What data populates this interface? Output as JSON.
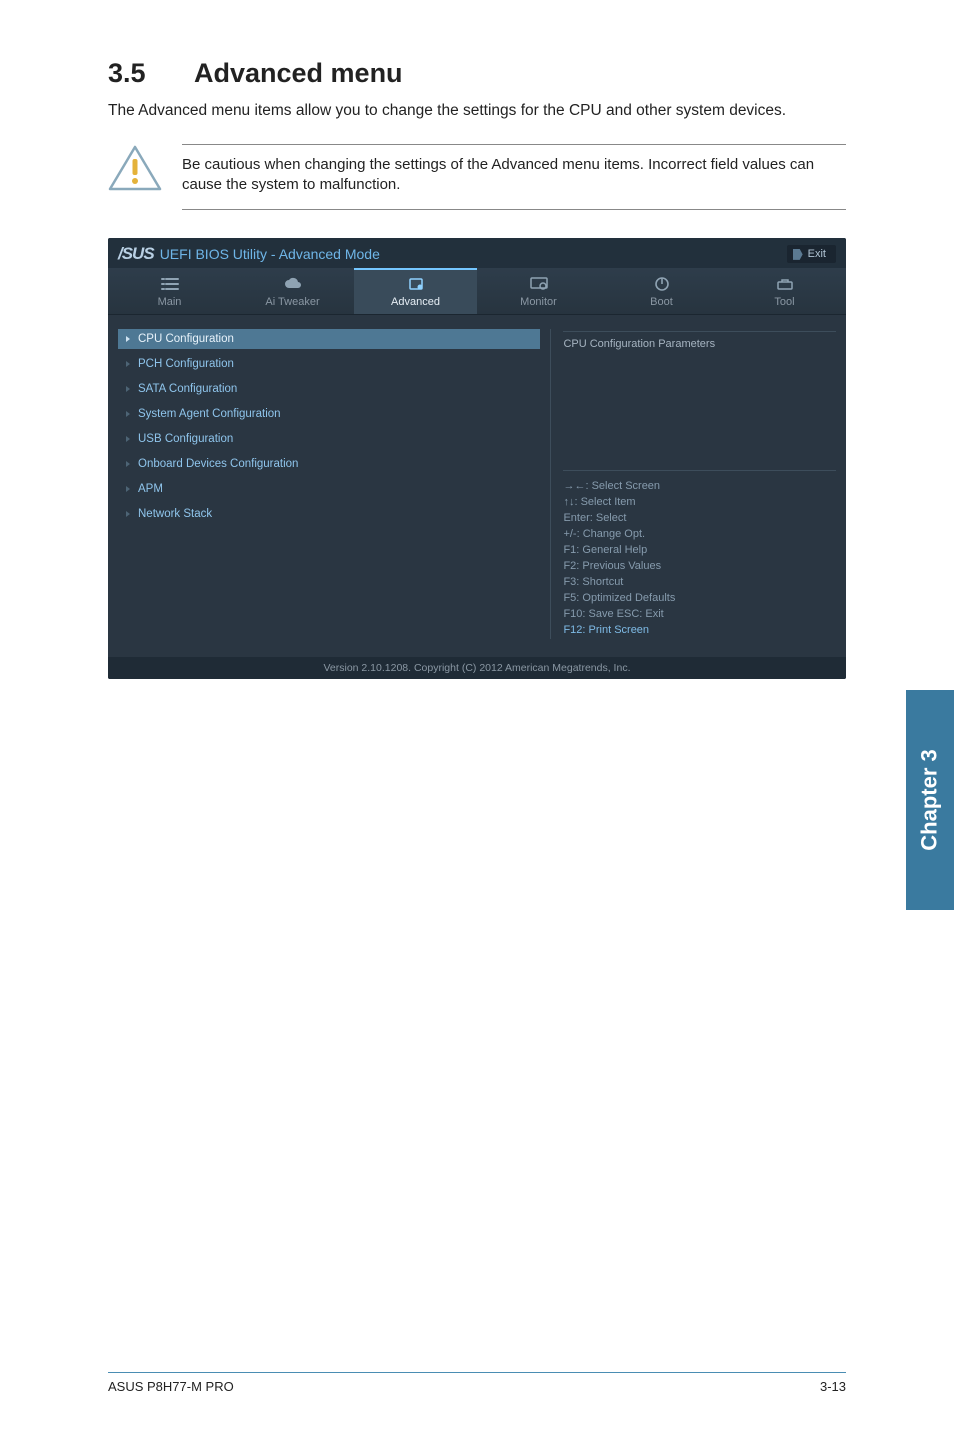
{
  "section": {
    "number": "3.5",
    "title": "Advanced menu"
  },
  "intro": "The Advanced menu items allow you to change the settings for the CPU and other system devices.",
  "caution": "Be cautious when changing the settings of the Advanced menu items. Incorrect field values can cause the system to malfunction.",
  "bios": {
    "logo": "/SUS",
    "title": "UEFI BIOS Utility - Advanced Mode",
    "exit_label": "Exit",
    "tabs": [
      {
        "label": "Main"
      },
      {
        "label": "Ai  Tweaker"
      },
      {
        "label": "Advanced"
      },
      {
        "label": "Monitor"
      },
      {
        "label": "Boot"
      },
      {
        "label": "Tool"
      }
    ],
    "menu": [
      {
        "label": "CPU Configuration",
        "selected": true
      },
      {
        "label": "PCH Configuration"
      },
      {
        "label": "SATA Configuration"
      },
      {
        "label": "System Agent Configuration"
      },
      {
        "label": "USB Configuration"
      },
      {
        "label": "Onboard Devices Configuration"
      },
      {
        "label": "APM"
      },
      {
        "label": "Network Stack"
      }
    ],
    "right_title": "CPU Configuration Parameters",
    "help": {
      "l1": "→←:  Select Screen",
      "l2": "↑↓:  Select Item",
      "l3": "Enter:  Select",
      "l4": "+/-:  Change Opt.",
      "l5": "F1:  General Help",
      "l6": "F2:  Previous Values",
      "l7": "F3:  Shortcut",
      "l8": "F5:  Optimized Defaults",
      "l9": "F10:  Save   ESC:  Exit",
      "l10": "F12: Print Screen"
    },
    "footer": "Version  2.10.1208.   Copyright  (C)  2012  American  Megatrends,  Inc."
  },
  "side_tab": "Chapter 3",
  "page_footer": {
    "left": "ASUS P8H77-M PRO",
    "right": "3-13"
  }
}
